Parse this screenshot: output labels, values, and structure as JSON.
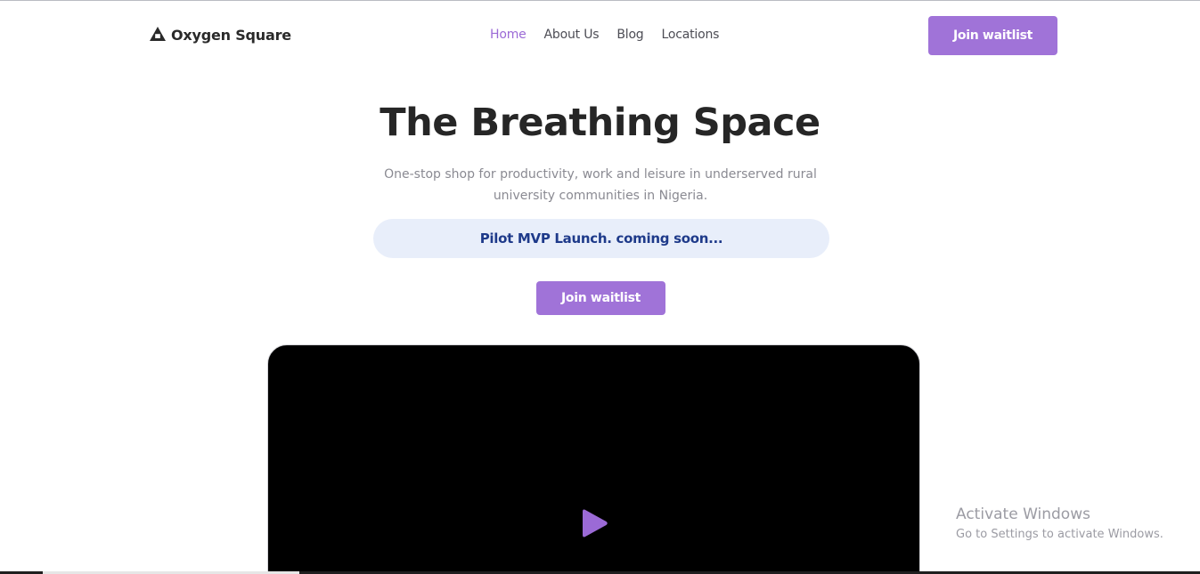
{
  "header": {
    "brand": "Oxygen Square",
    "nav": [
      {
        "label": "Home",
        "active": true
      },
      {
        "label": "About Us",
        "active": false
      },
      {
        "label": "Blog",
        "active": false
      },
      {
        "label": "Locations",
        "active": false
      }
    ],
    "cta_label": "Join waitlist"
  },
  "hero": {
    "title": "The Breathing Space",
    "subtitle": "One-stop shop for productivity, work and leisure in underserved rural university communities in Nigeria.",
    "pill_text": "Pilot MVP Launch. coming soon...",
    "cta_label": "Join waitlist"
  },
  "video": {
    "play_icon": "play-icon"
  },
  "watermark": {
    "title": "Activate Windows",
    "subtitle": "Go to Settings to activate Windows."
  },
  "colors": {
    "accent": "#a073d8",
    "active_nav": "#9b6ad6",
    "pill_bg": "#e8eefa",
    "pill_text": "#1e3a8a",
    "title": "#262626"
  }
}
